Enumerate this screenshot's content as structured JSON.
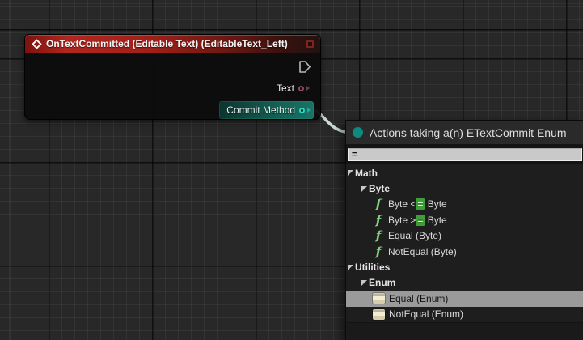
{
  "graph": {
    "node": {
      "title": "OnTextCommitted (Editable Text) (EditableText_Left)",
      "pins": {
        "text_label": "Text",
        "commit_label": "Commit Method"
      }
    },
    "colors": {
      "node_header_red": "#a8231b",
      "wire": "#d2e6de",
      "exec_pin": "#b9b9b9",
      "text_pin": "#8a4a62",
      "commit_pin": "#2bd6bd",
      "commit_highlight": "#136054"
    }
  },
  "menu": {
    "title": "Actions taking a(n) ETextCommit Enum",
    "search_value": "=",
    "rows": [
      {
        "label": "Math",
        "type": "category",
        "level": 0
      },
      {
        "label": "Byte",
        "type": "category",
        "level": 1
      },
      {
        "label": "Byte <= Byte",
        "pre": "Byte <",
        "match": "=",
        "post": " Byte",
        "type": "function",
        "level": 2
      },
      {
        "label": "Byte >= Byte",
        "pre": "Byte >",
        "match": "=",
        "post": " Byte",
        "type": "function",
        "level": 2
      },
      {
        "label": "Equal (Byte)",
        "type": "function",
        "level": 2
      },
      {
        "label": "NotEqual (Byte)",
        "type": "function",
        "level": 2
      },
      {
        "label": "Utilities",
        "type": "category",
        "level": 0
      },
      {
        "label": "Enum",
        "type": "category",
        "level": 1
      },
      {
        "label": "Equal (Enum)",
        "type": "enum-node",
        "level": 2,
        "selected": true
      },
      {
        "label": "NotEqual (Enum)",
        "type": "enum-node",
        "level": 2
      }
    ],
    "colors": {
      "accent_teal": "#0e8b7e",
      "selection_gray": "#9a9a9a",
      "match_green": "#3f9e37",
      "function_icon_green": "#7fd47f",
      "enum_icon_tan": "#d5cdab"
    }
  }
}
